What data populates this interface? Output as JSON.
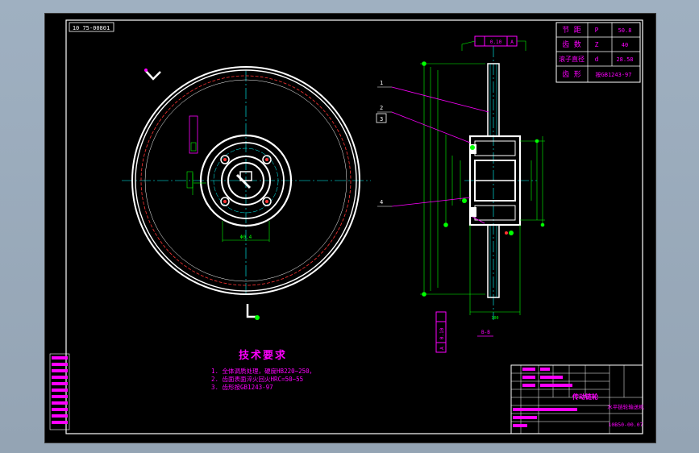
{
  "drawing": {
    "code_top": "10 75-00801",
    "param_table": [
      {
        "name": "节 距",
        "symbol": "P",
        "value": "50.8"
      },
      {
        "name": "齿 数",
        "symbol": "Z",
        "value": "40"
      },
      {
        "name": "滚子直径",
        "symbol": "d",
        "value": "28.58"
      },
      {
        "name": "齿 形",
        "symbol": "",
        "value": "按GB1243-97"
      }
    ],
    "tech_title": "技术要求",
    "tech_reqs": [
      "1. 全体调质处理，硬度HB220~250，",
      "2. 齿面表面淬火回火HRC=50~55",
      "3. 齿形按GB1243-97"
    ],
    "callouts": [
      "1",
      "2",
      "3",
      "4"
    ],
    "section_label": "B-B",
    "tolerance_top": "0.10",
    "tolerance_top_datum": "A",
    "tolerance_bottom": "0.10",
    "tolerance_bottom_datum": "A",
    "dim_keyway": "Φ0.4",
    "dim_width": "100",
    "title_block": {
      "part_name": "传动链轮",
      "drawing_name": "水平链轮输送机",
      "drawing_no": "10B50-00.07"
    }
  }
}
